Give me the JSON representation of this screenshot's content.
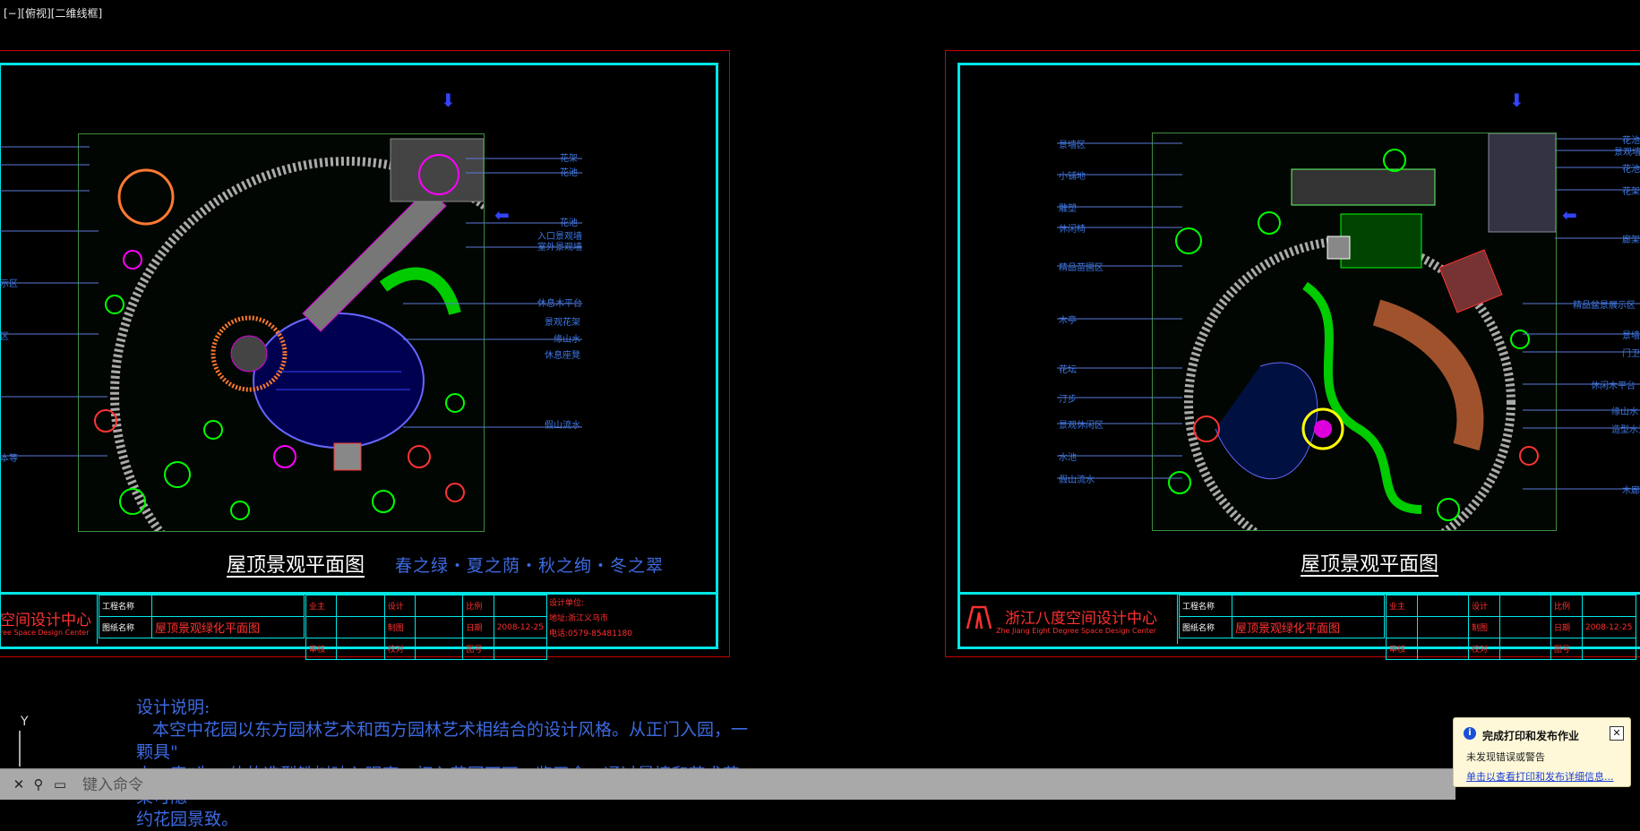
{
  "viewport_label": "[−][俯视][二维线框]",
  "drawing_left": {
    "plan_title": "屋顶景观平面图",
    "plan_subtitle": "春之绿・夏之荫・秋之绚・冬之翠",
    "left_labels": [
      "",
      "",
      "",
      "",
      "",
      "示区",
      "",
      "区",
      "",
      "",
      "",
      "",
      "",
      "本等"
    ],
    "right_labels": [
      "花架",
      "花池",
      "花池",
      "入口景观墙",
      "室外景观墙",
      "休息木平台",
      "景观花架",
      "缘山水",
      "休息座凳",
      "假山流水"
    ],
    "title_block": {
      "company_cn": "空间设计中心",
      "company_en": "ree Space Design Center",
      "project_name_label": "工程名称",
      "project_name_value": "",
      "drawing_name_label": "图纸名称",
      "drawing_name_value": "屋顶景观绿化平面图",
      "owner_label": "业主",
      "approve_label": "审核",
      "design_label": "设计",
      "draw_label": "制图",
      "check_label": "校对",
      "scale_label": "比例",
      "date_label": "日期",
      "date_value": "2008-12-25",
      "drawing_no_label": "图号",
      "unit_label": "设计单位:",
      "address": "地址:浙江义乌市",
      "phone": "电话:0579-85481180"
    }
  },
  "drawing_right": {
    "plan_title": "屋顶景观平面图",
    "left_labels": [
      "景墙区",
      "小铺地",
      "雕塑",
      "休闲椅",
      "精品苗圃区",
      "木亭",
      "花坛",
      "汀步",
      "景观休闲区",
      "水池",
      "假山流水"
    ],
    "right_labels": [
      "花池",
      "景观墙",
      "花池",
      "花架",
      "廊架",
      "精品盆景展示区",
      "景墙",
      "门卫",
      "休闲木平台",
      "缘山水",
      "造型水景",
      "木廊"
    ],
    "title_block": {
      "company_cn": "浙江八度空间设计中心",
      "company_en": "Zhe Jiang Eight Degree Space Design Center",
      "project_name_label": "工程名称",
      "project_name_value": "",
      "drawing_name_label": "图纸名称",
      "drawing_name_value": "屋顶景观绿化平面图",
      "owner_label": "业主",
      "approve_label": "审核",
      "design_label": "设计",
      "draw_label": "制图",
      "check_label": "校对",
      "scale_label": "比例",
      "date_label": "日期",
      "date_value": "2008-12-25",
      "drawing_no_label": "图号"
    }
  },
  "design_notes": {
    "heading": "设计说明:",
    "line1": "本空中花园以东方园林艺术和西方园林艺术相结合的设计风格。从正门入园，一颗具\"",
    "line2": "古、奇\"为一体的造型铁树映入眼帘，初入花园不可一览无余，通过景墙和艺术花架可隐",
    "line3": "约花园景致。"
  },
  "ucs": {
    "y_label": "Y"
  },
  "command_line": {
    "placeholder": "键入命令"
  },
  "notification": {
    "title": "完成打印和发布作业",
    "message": "未发现错误或警告",
    "link": "单击以查看打印和发布详细信息..."
  }
}
